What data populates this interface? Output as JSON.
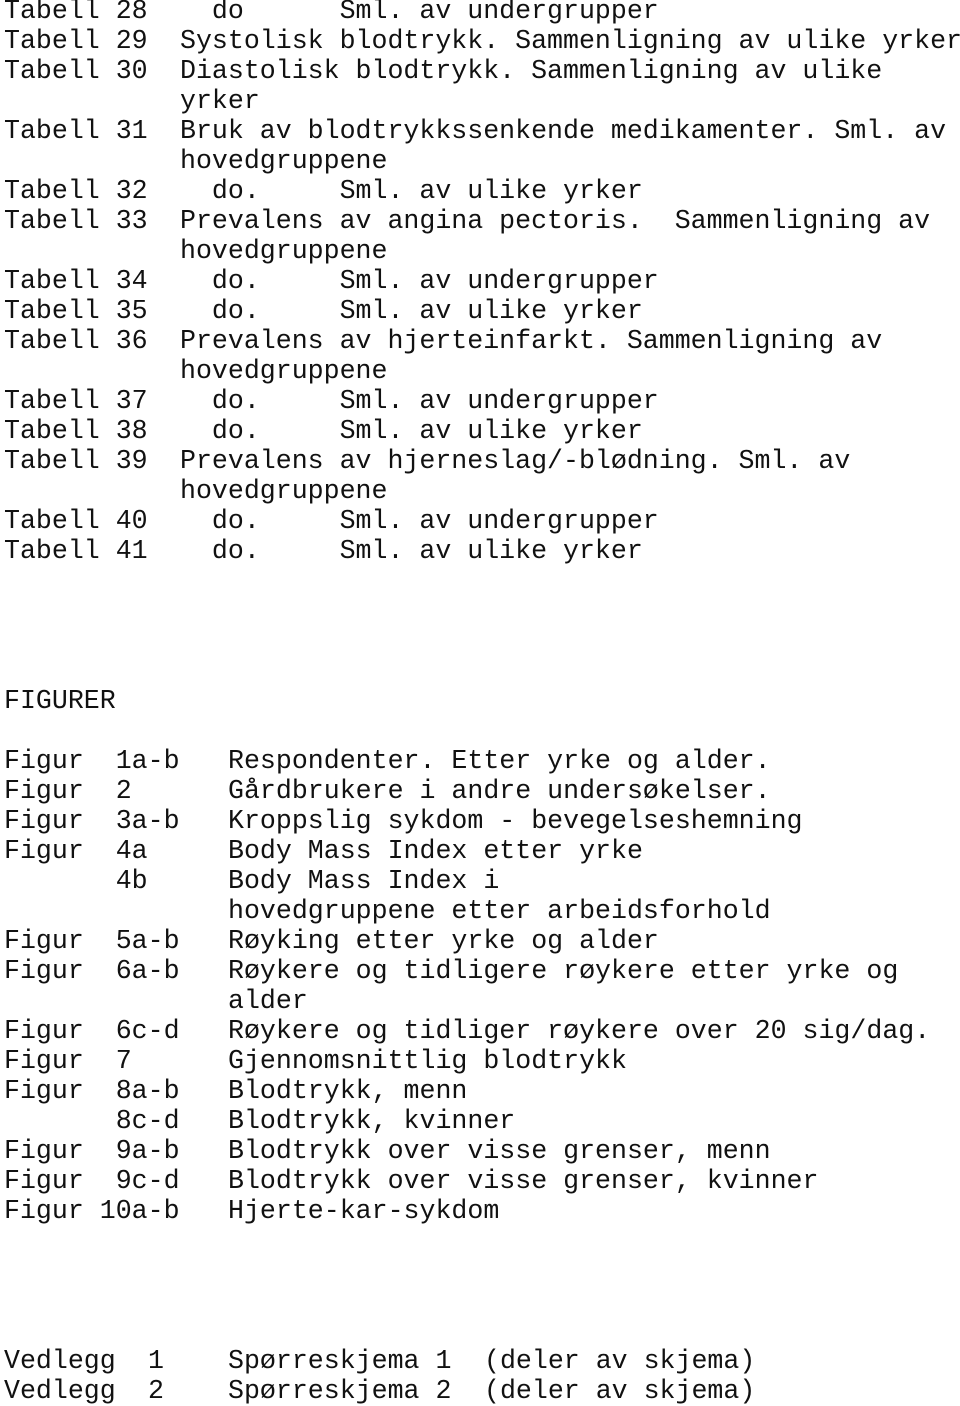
{
  "tables": [
    {
      "label": "Tabell 28",
      "lines": [
        "  do      Sml. av undergrupper"
      ]
    },
    {
      "label": "Tabell 29",
      "lines": [
        "Systolisk blodtrykk. Sammenligning av ulike yrker"
      ]
    },
    {
      "label": "Tabell 30",
      "lines": [
        "Diastolisk blodtrykk. Sammenligning av ulike",
        "yrker"
      ]
    },
    {
      "label": "Tabell 31",
      "lines": [
        "Bruk av blodtrykkssenkende medikamenter. Sml. av",
        "hovedgruppene"
      ]
    },
    {
      "label": "Tabell 32",
      "lines": [
        "  do.     Sml. av ulike yrker"
      ]
    },
    {
      "label": "Tabell 33",
      "lines": [
        "Prevalens av angina pectoris.  Sammenligning av",
        "hovedgruppene"
      ]
    },
    {
      "label": "Tabell 34",
      "lines": [
        "  do.     Sml. av undergrupper"
      ]
    },
    {
      "label": "Tabell 35",
      "lines": [
        "  do.     Sml. av ulike yrker"
      ]
    },
    {
      "label": "Tabell 36",
      "lines": [
        "Prevalens av hjerteinfarkt. Sammenligning av",
        "hovedgruppene"
      ]
    },
    {
      "label": "Tabell 37",
      "lines": [
        "  do.     Sml. av undergrupper"
      ]
    },
    {
      "label": "Tabell 38",
      "lines": [
        "  do.     Sml. av ulike yrker"
      ]
    },
    {
      "label": "Tabell 39",
      "lines": [
        "Prevalens av hjerneslag/-blødning. Sml. av",
        "hovedgruppene"
      ]
    },
    {
      "label": "Tabell 40",
      "lines": [
        "  do.     Sml. av undergrupper"
      ]
    },
    {
      "label": "Tabell 41",
      "lines": [
        "  do.     Sml. av ulike yrker"
      ]
    }
  ],
  "figures_heading": "FIGURER",
  "figures": [
    {
      "label": "Figur  1a-b",
      "lines": [
        "Respondenter. Etter yrke og alder."
      ]
    },
    {
      "label": "Figur  2",
      "lines": [
        "Gårdbrukere i andre undersøkelser."
      ]
    },
    {
      "label": "Figur  3a-b",
      "lines": [
        "Kroppslig sykdom - bevegelseshemning"
      ]
    },
    {
      "label": "Figur  4a",
      "lines": [
        "Body Mass Index etter yrke"
      ]
    },
    {
      "label": "       4b",
      "lines": [
        "Body Mass Index i",
        "hovedgruppene etter arbeidsforhold"
      ]
    },
    {
      "label": "Figur  5a-b",
      "lines": [
        "Røyking etter yrke og alder"
      ]
    },
    {
      "label": "Figur  6a-b",
      "lines": [
        "Røykere og tidligere røykere etter yrke og",
        "alder"
      ]
    },
    {
      "label": "Figur  6c-d",
      "lines": [
        "Røykere og tidliger røykere over 20 sig/dag."
      ]
    },
    {
      "label": "Figur  7",
      "lines": [
        "Gjennomsnittlig blodtrykk"
      ]
    },
    {
      "label": "Figur  8a-b",
      "lines": [
        "Blodtrykk, menn"
      ]
    },
    {
      "label": "       8c-d",
      "lines": [
        "Blodtrykk, kvinner"
      ]
    },
    {
      "label": "Figur  9a-b",
      "lines": [
        "Blodtrykk over visse grenser, menn"
      ]
    },
    {
      "label": "Figur  9c-d",
      "lines": [
        "Blodtrykk over visse grenser, kvinner"
      ]
    },
    {
      "label": "Figur 10a-b",
      "lines": [
        "Hjerte-kar-sykdom"
      ]
    }
  ],
  "appendices": [
    {
      "label": "Vedlegg",
      "number": "1",
      "title": "Spørreskjema 1",
      "note": "(deler av skjema)"
    },
    {
      "label": "Vedlegg",
      "number": "2",
      "title": "Spørreskjema 2",
      "note": "(deler av skjema)"
    }
  ]
}
